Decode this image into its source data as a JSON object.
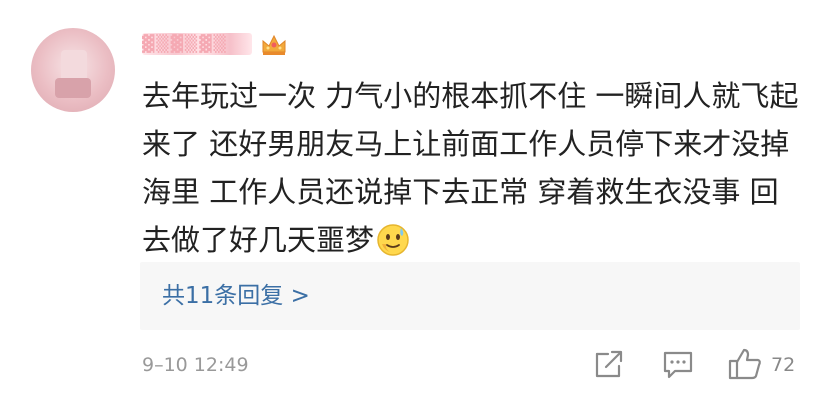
{
  "comment": {
    "username": "▓▒▓▒▓▒",
    "text": "去年玩过一次 力气小的根本抓不住 一瞬间人就飞起来了 还好男朋友马上让前面工作人员停下来才没掉海里 工作人员还说掉下去正常 穿着救生衣没事 回去做了好几天噩梦",
    "emoji": "sweat-smile-face",
    "badge_icon": "crown-icon",
    "replies_label": "共11条回复 >",
    "timestamp": "9–10 12:49",
    "like_count": "72"
  },
  "colors": {
    "link": "#3b6fa5",
    "meta": "#999999",
    "reply_bg": "#f7f7f7"
  }
}
